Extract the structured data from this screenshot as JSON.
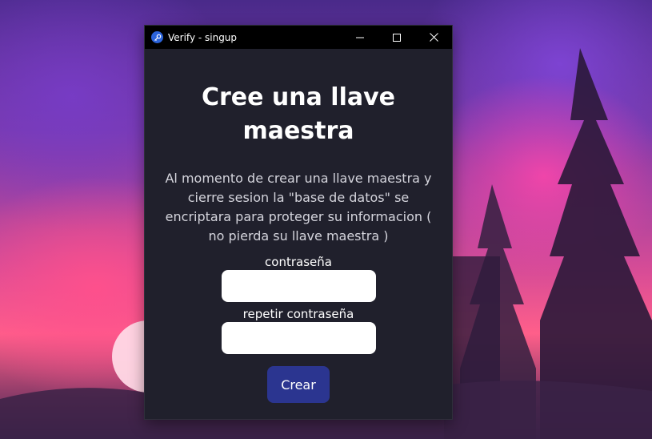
{
  "window": {
    "title": "Verify - singup",
    "icon": "key-icon",
    "controls": {
      "minimize": "minimize-icon",
      "maximize": "maximize-icon",
      "close": "close-icon"
    }
  },
  "form": {
    "heading": "Cree una llave maestra",
    "description": "Al momento de crear una llave maestra y cierre sesion la \"base de datos\" se encriptara para proteger su informacion ( no pierda su llave maestra )",
    "password_label": "contraseña",
    "password_value": "",
    "repeat_label": "repetir contraseña",
    "repeat_value": "",
    "submit_label": "Crear"
  },
  "colors": {
    "window_background": "#20202c",
    "titlebar_background": "#000000",
    "button_background": "#2b3590",
    "text": "#ffffff",
    "description_text": "#d4d4dc"
  }
}
